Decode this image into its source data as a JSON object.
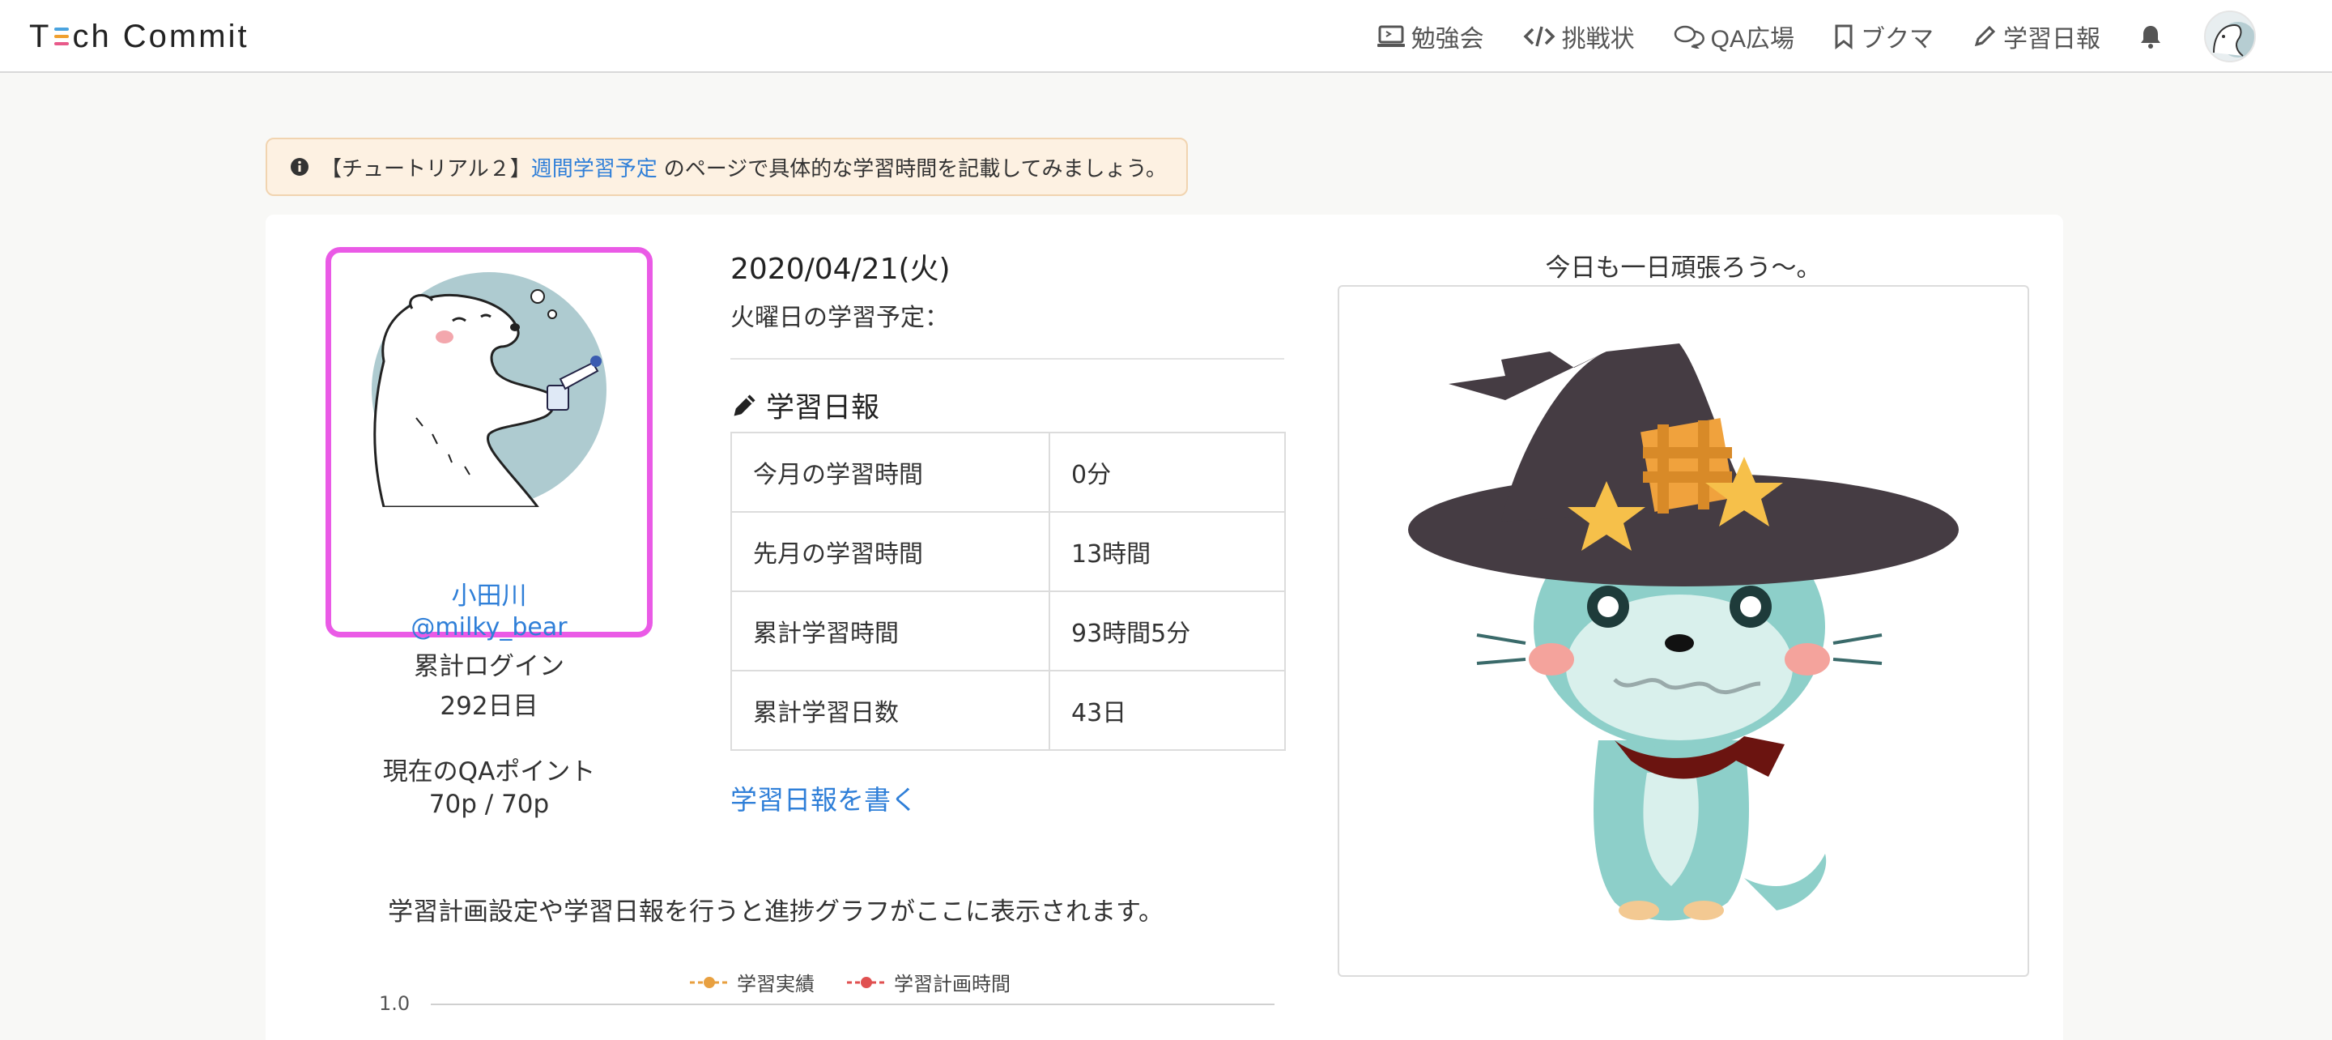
{
  "brand": {
    "prefix": "T",
    "suffix": "ch Commit"
  },
  "nav": {
    "items": [
      {
        "label": "勉強会",
        "icon": "laptop-icon"
      },
      {
        "label": "挑戦状",
        "icon": "code-icon"
      },
      {
        "label": "QA広場",
        "icon": "chat-icon"
      },
      {
        "label": "ブクマ",
        "icon": "bookmark-icon"
      },
      {
        "label": "学習日報",
        "icon": "pencil-icon"
      }
    ],
    "bell_icon": "bell-icon",
    "avatar_icon": "avatar"
  },
  "alert": {
    "prefix": "【チュートリアル２】",
    "link": "週間学習予定",
    "suffix": "のページで具体的な学習時間を記載してみましょう。"
  },
  "profile": {
    "name": "小田川",
    "handle": "@milky_bear",
    "login_label": "累計ログイン",
    "login_value": "292日目",
    "qa_label": "現在のQAポイント",
    "qa_value": "70p / 70p"
  },
  "today": {
    "date": "2020/04/21(火)",
    "plan_label": "火曜日の学習予定："
  },
  "report": {
    "title": "学習日報",
    "rows": [
      {
        "label": "今月の学習時間",
        "value": "0分"
      },
      {
        "label": "先月の学習時間",
        "value": "13時間"
      },
      {
        "label": "累計学習時間",
        "value": "93時間5分"
      },
      {
        "label": "累計学習日数",
        "value": "43日"
      }
    ],
    "write_link": "学習日報を書く"
  },
  "greeting": "今日も一日頑張ろう〜。",
  "graph": {
    "message": "学習計画設定や学習日報を行うと進捗グラフがここに表示されます。",
    "legend": [
      {
        "label": "学習実績",
        "color": "#e8a040"
      },
      {
        "label": "学習計画時間",
        "color": "#e05050"
      }
    ],
    "ytick": "1.0"
  },
  "colors": {
    "link": "#2f7fd8",
    "highlight": "#ea5ae6",
    "alert_bg": "#fdf1e2"
  }
}
